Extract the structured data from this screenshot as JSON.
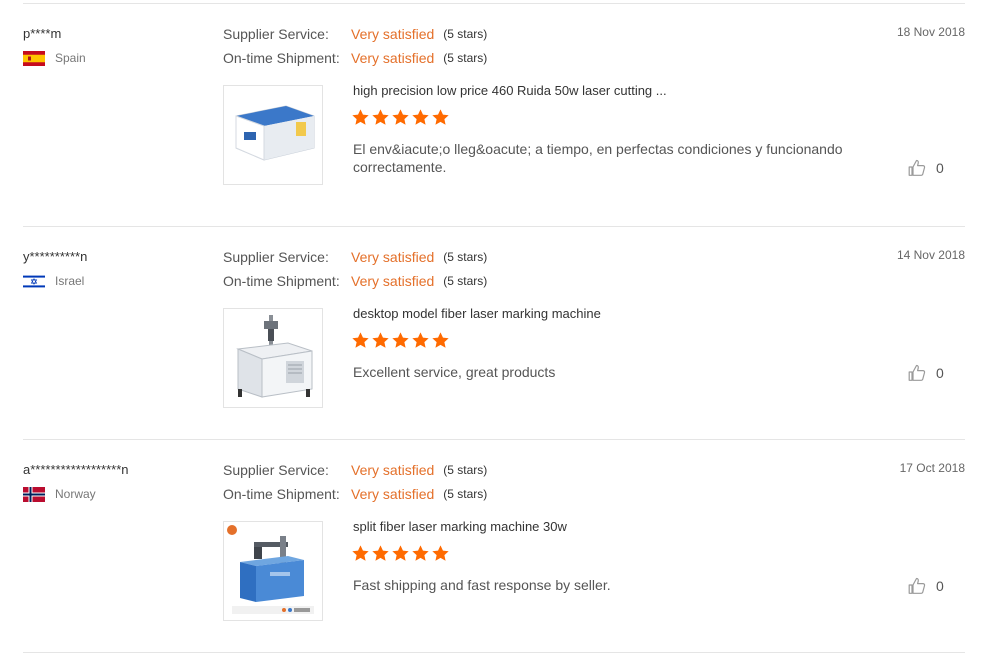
{
  "labels": {
    "supplier_service": "Supplier Service:",
    "ontime_shipment": "On-time Shipment:"
  },
  "accent_color": "#e4702a",
  "reviews": [
    {
      "username": "p****m",
      "country": "Spain",
      "flag_icon": "flag-spain",
      "date": "18 Nov 2018",
      "supplier_service": "Very satisfied",
      "supplier_service_stars": "(5 stars)",
      "ontime_shipment": "Very satisfied",
      "ontime_shipment_stars": "(5 stars)",
      "product_title": "high precision low price 460 Ruida 50w laser cutting ...",
      "rating": 5,
      "comment": "El env&iacute;o lleg&oacute; a tiempo, en perfectas condiciones y funcionando correctamente.",
      "likes": "0"
    },
    {
      "username": "y**********n",
      "country": "Israel",
      "flag_icon": "flag-israel",
      "date": "14 Nov 2018",
      "supplier_service": "Very satisfied",
      "supplier_service_stars": "(5 stars)",
      "ontime_shipment": "Very satisfied",
      "ontime_shipment_stars": "(5 stars)",
      "product_title": "desktop model fiber laser marking machine",
      "rating": 5,
      "comment": "Excellent service, great products",
      "likes": "0"
    },
    {
      "username": "a******************n",
      "country": "Norway",
      "flag_icon": "flag-norway",
      "date": "17 Oct 2018",
      "supplier_service": "Very satisfied",
      "supplier_service_stars": "(5 stars)",
      "ontime_shipment": "Very satisfied",
      "ontime_shipment_stars": "(5 stars)",
      "product_title": "split fiber laser marking machine 30w",
      "rating": 5,
      "comment": "Fast shipping and fast response by seller.",
      "likes": "0"
    }
  ]
}
